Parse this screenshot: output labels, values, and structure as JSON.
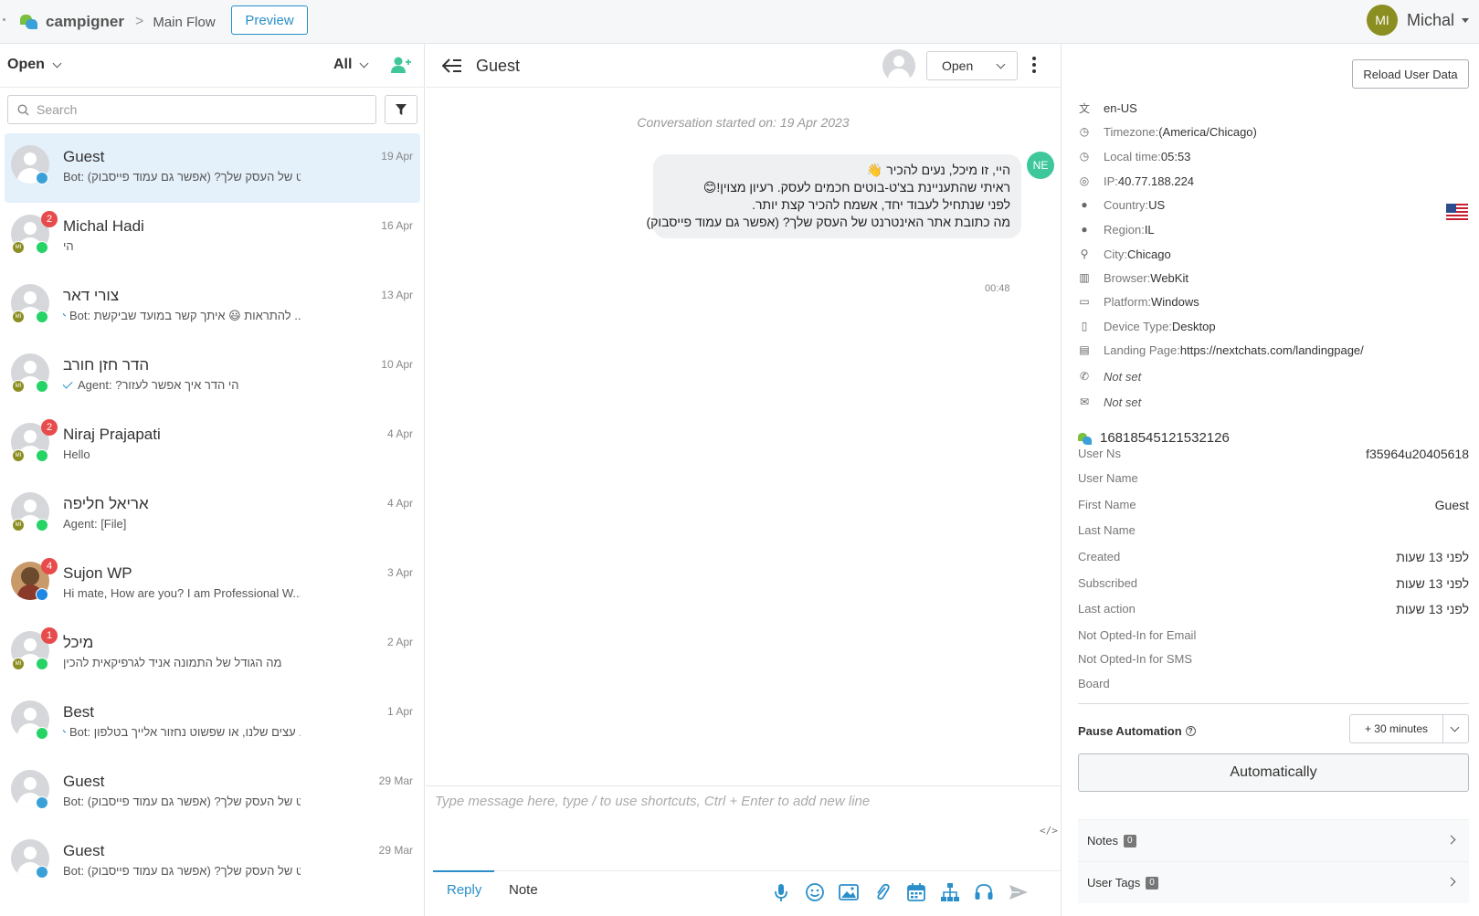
{
  "header": {
    "brand": "campigner",
    "breadcrumb_sep": ">",
    "breadcrumb": "Main Flow",
    "preview_label": "Preview",
    "user_initials": "MI",
    "user_name": "Michal"
  },
  "colors": {
    "accent": "#2a8fc9",
    "badge": "#e84b4b",
    "whatsapp": "#25d366",
    "agent_avatar": "#8b8e20",
    "active_row": "#e4f0fa"
  },
  "left": {
    "status_filter": "Open",
    "scope_filter": "All",
    "search_placeholder": "Search",
    "conversations": [
      {
        "name": "Guest",
        "date": "19 Apr",
        "preview": "Bot: (אפשר גם עמוד פייסבוק) ?נט של העסק שלך",
        "badge": "",
        "channel": "web",
        "agent": false,
        "tick": false,
        "active": true,
        "photo": false
      },
      {
        "name": "Michal Hadi",
        "date": "16 Apr",
        "preview": "הי",
        "badge": "2",
        "channel": "wa",
        "agent": true,
        "tick": false,
        "active": false,
        "photo": false
      },
      {
        "name": "צורי דאר",
        "date": "13 Apr",
        "preview": "Bot: להתראות 😃 איתך קשר במועד שביקשת ...",
        "badge": "",
        "channel": "wa",
        "agent": true,
        "tick": true,
        "active": false,
        "photo": false
      },
      {
        "name": "הדר חזן חורב",
        "date": "10 Apr",
        "preview": "Agent: ?הי הדר איך אפשר לעזור",
        "badge": "",
        "channel": "wa",
        "agent": true,
        "tick": true,
        "active": false,
        "photo": false
      },
      {
        "name": "Niraj Prajapati",
        "date": "4 Apr",
        "preview": "Hello",
        "badge": "2",
        "channel": "wa",
        "agent": true,
        "tick": false,
        "active": false,
        "photo": false
      },
      {
        "name": "אריאל חליפה",
        "date": "4 Apr",
        "preview": "Agent: [File]",
        "badge": "",
        "channel": "wa",
        "agent": true,
        "tick": false,
        "active": false,
        "photo": false
      },
      {
        "name": "Sujon WP",
        "date": "3 Apr",
        "preview": "Hi mate, How are you? I am Professional W...",
        "badge": "4",
        "channel": "ms",
        "agent": false,
        "tick": false,
        "active": false,
        "photo": true
      },
      {
        "name": "מיכל",
        "date": "2 Apr",
        "preview": "מה הגודל של התמונה אניד לגרפיקאית להכין",
        "badge": "1",
        "channel": "wa",
        "agent": true,
        "tick": false,
        "active": false,
        "photo": false
      },
      {
        "name": "Best",
        "date": "1 Apr",
        "preview": "Bot: עצים שלנו, או שפשוט נחזור אלייך בטלפון ...",
        "badge": "",
        "channel": "wa",
        "agent": false,
        "tick": true,
        "active": false,
        "photo": false
      },
      {
        "name": "Guest",
        "date": "29 Mar",
        "preview": "Bot: (אפשר גם עמוד פייסבוק) ?נט של העסק שלך",
        "badge": "",
        "channel": "web",
        "agent": false,
        "tick": false,
        "active": false,
        "photo": false
      },
      {
        "name": "Guest",
        "date": "29 Mar",
        "preview": "Bot: (אפשר גם עמוד פייסבוק) ?נט של העסק שלך",
        "badge": "",
        "channel": "web",
        "agent": false,
        "tick": false,
        "active": false,
        "photo": false
      }
    ]
  },
  "middle": {
    "title": "Guest",
    "status": "Open",
    "conversation_started": "Conversation started on: 19 Apr 2023",
    "bubble_lines": [
      "היי, זו מיכל, נעים להכיר 👋",
      "ראיתי שהתעניינת בצ'ט-בוטים חכמים לעסק. רעיון מצוין!😊",
      "לפני שנתחיל לעבוד יחד, אשמח להכיר קצת יותר.",
      "מה כתובת אתר האינטרנט של העסק שלך? (אפשר גם עמוד פייסבוק)"
    ],
    "message_time": "00:48",
    "sender_initials": "NE",
    "compose_placeholder": "Type message here, type / to use shortcuts, Ctrl + Enter to add new line",
    "code_toggle": "</>",
    "tab_reply": "Reply",
    "tab_note": "Note",
    "toolbar_icons": [
      "microphone-icon",
      "emoji-icon",
      "image-icon",
      "attachment-icon",
      "calendar-icon",
      "flow-icon",
      "headset-icon",
      "send-icon"
    ]
  },
  "right": {
    "reload_label": "Reload User Data",
    "info": [
      {
        "icon": "language-icon",
        "label": "",
        "value": "en-US"
      },
      {
        "icon": "clock-icon",
        "label": "Timezone: ",
        "value": "(America/Chicago)"
      },
      {
        "icon": "clock-icon",
        "label": "Local time: ",
        "value": "05:53"
      },
      {
        "icon": "ip-icon",
        "label": "IP: ",
        "value": "40.77.188.224"
      },
      {
        "icon": "globe-icon",
        "label": "Country: ",
        "value": "US"
      },
      {
        "icon": "globe-icon",
        "label": "Region: ",
        "value": "IL"
      },
      {
        "icon": "pin-icon",
        "label": "City: ",
        "value": "Chicago"
      },
      {
        "icon": "browser-icon",
        "label": "Browser: ",
        "value": "WebKit"
      },
      {
        "icon": "monitor-icon",
        "label": "Platform: ",
        "value": "Windows"
      },
      {
        "icon": "device-icon",
        "label": "Device Type: ",
        "value": "Desktop"
      },
      {
        "icon": "landing-icon",
        "label": "Landing Page: ",
        "value": "https://nextchats.com/landingpage/"
      },
      {
        "icon": "phone-icon",
        "label": "",
        "value": "Not set"
      },
      {
        "icon": "email-icon",
        "label": "",
        "value": "Not set"
      }
    ],
    "user_id": "16818545121532126",
    "fields": [
      {
        "key": "User Ns",
        "value": "f35964u20405618"
      },
      {
        "key": "User Name",
        "value": ""
      },
      {
        "key": "First Name",
        "value": "Guest"
      },
      {
        "key": "Last Name",
        "value": ""
      },
      {
        "key": "Created",
        "value": "לפני 13 שעות"
      },
      {
        "key": "Subscribed",
        "value": "לפני 13 שעות"
      },
      {
        "key": "Last action",
        "value": "לפני 13 שעות"
      },
      {
        "key": "Not Opted-In for Email",
        "value": ""
      },
      {
        "key": "Not Opted-In for SMS",
        "value": ""
      },
      {
        "key": "Board",
        "value": ""
      }
    ],
    "pause_label": "Pause Automation",
    "pause_help": "?",
    "pause_value": "+ 30 minutes",
    "automatically_label": "Automatically",
    "notes_label": "Notes",
    "notes_count": "0",
    "tags_label": "User Tags",
    "tags_count": "0"
  }
}
